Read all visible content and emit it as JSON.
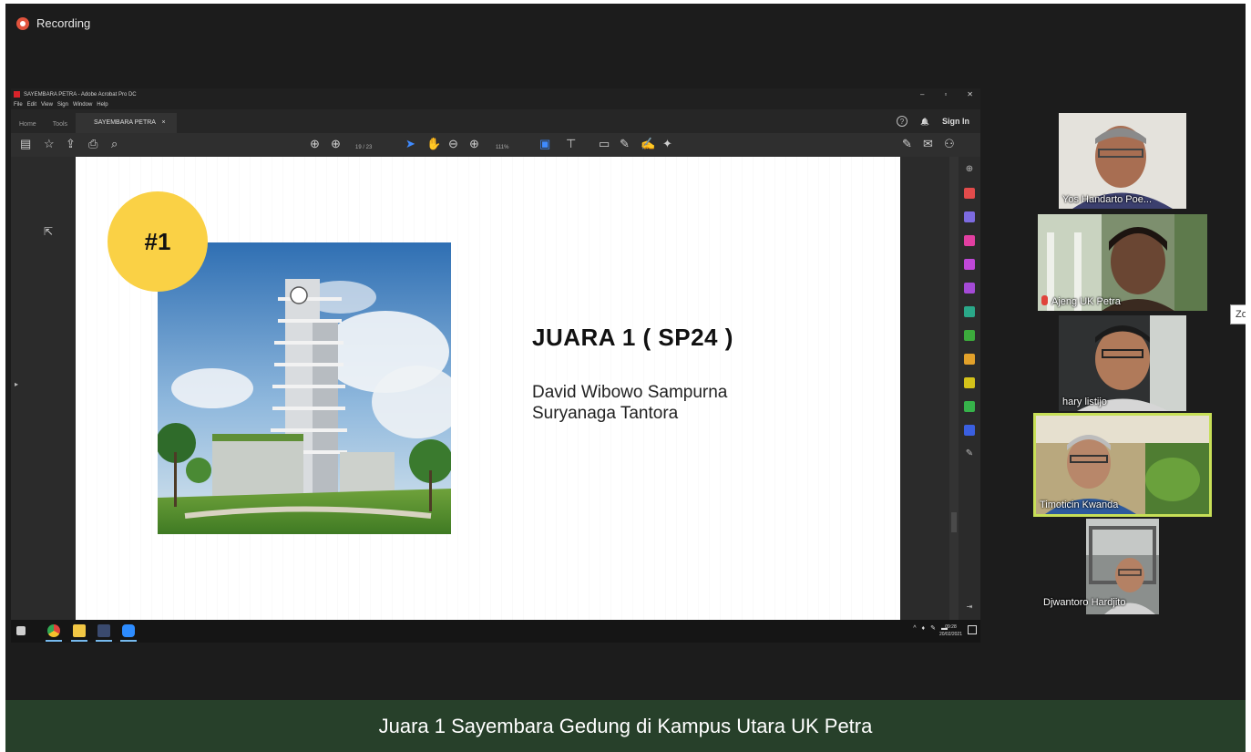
{
  "recording": {
    "label": "Recording"
  },
  "acrobat": {
    "window_title": "SAYEMBARA PETRA - Adobe Acrobat Pro DC",
    "window_controls": [
      "–",
      "▫",
      "✕"
    ],
    "menu": [
      "File",
      "Edit",
      "View",
      "Sign",
      "Window",
      "Help"
    ],
    "tabs": {
      "home": "Home",
      "tools": "Tools",
      "document": "SAYEMBARA PETRA",
      "close": "×"
    },
    "sign_in": "Sign In",
    "help_icon": "?",
    "bell_icon": "🔔",
    "page_indicator": "19 / 23",
    "zoom_level": "111%"
  },
  "slide": {
    "badge": "#1",
    "title": "JUARA 1 ( SP24 )",
    "names": [
      "David Wibowo Sampurna",
      "Suryanaga Tantora"
    ]
  },
  "taskbar": {
    "time": "09:28",
    "date": "20/02/2021"
  },
  "participants": [
    {
      "name": "Yos Handarto Poe...",
      "muted": false,
      "speaking": false
    },
    {
      "name": "Ajeng UK Petra",
      "muted": true,
      "speaking": false
    },
    {
      "name": "hary listijo",
      "muted": false,
      "speaking": false
    },
    {
      "name": "Timoticin Kwanda",
      "muted": false,
      "speaking": true
    },
    {
      "name": "Djwantoro Hardjito",
      "muted": false,
      "speaking": false
    }
  ],
  "zoom_edge_label": "Zo",
  "caption": "Juara 1 Sayembara Gedung di Kampus Utara UK Petra",
  "colors": {
    "badge": "#fad145",
    "speaking_border": "#c7df57",
    "caption_bg": "#27402a",
    "recording_dot": "#e0533d"
  }
}
